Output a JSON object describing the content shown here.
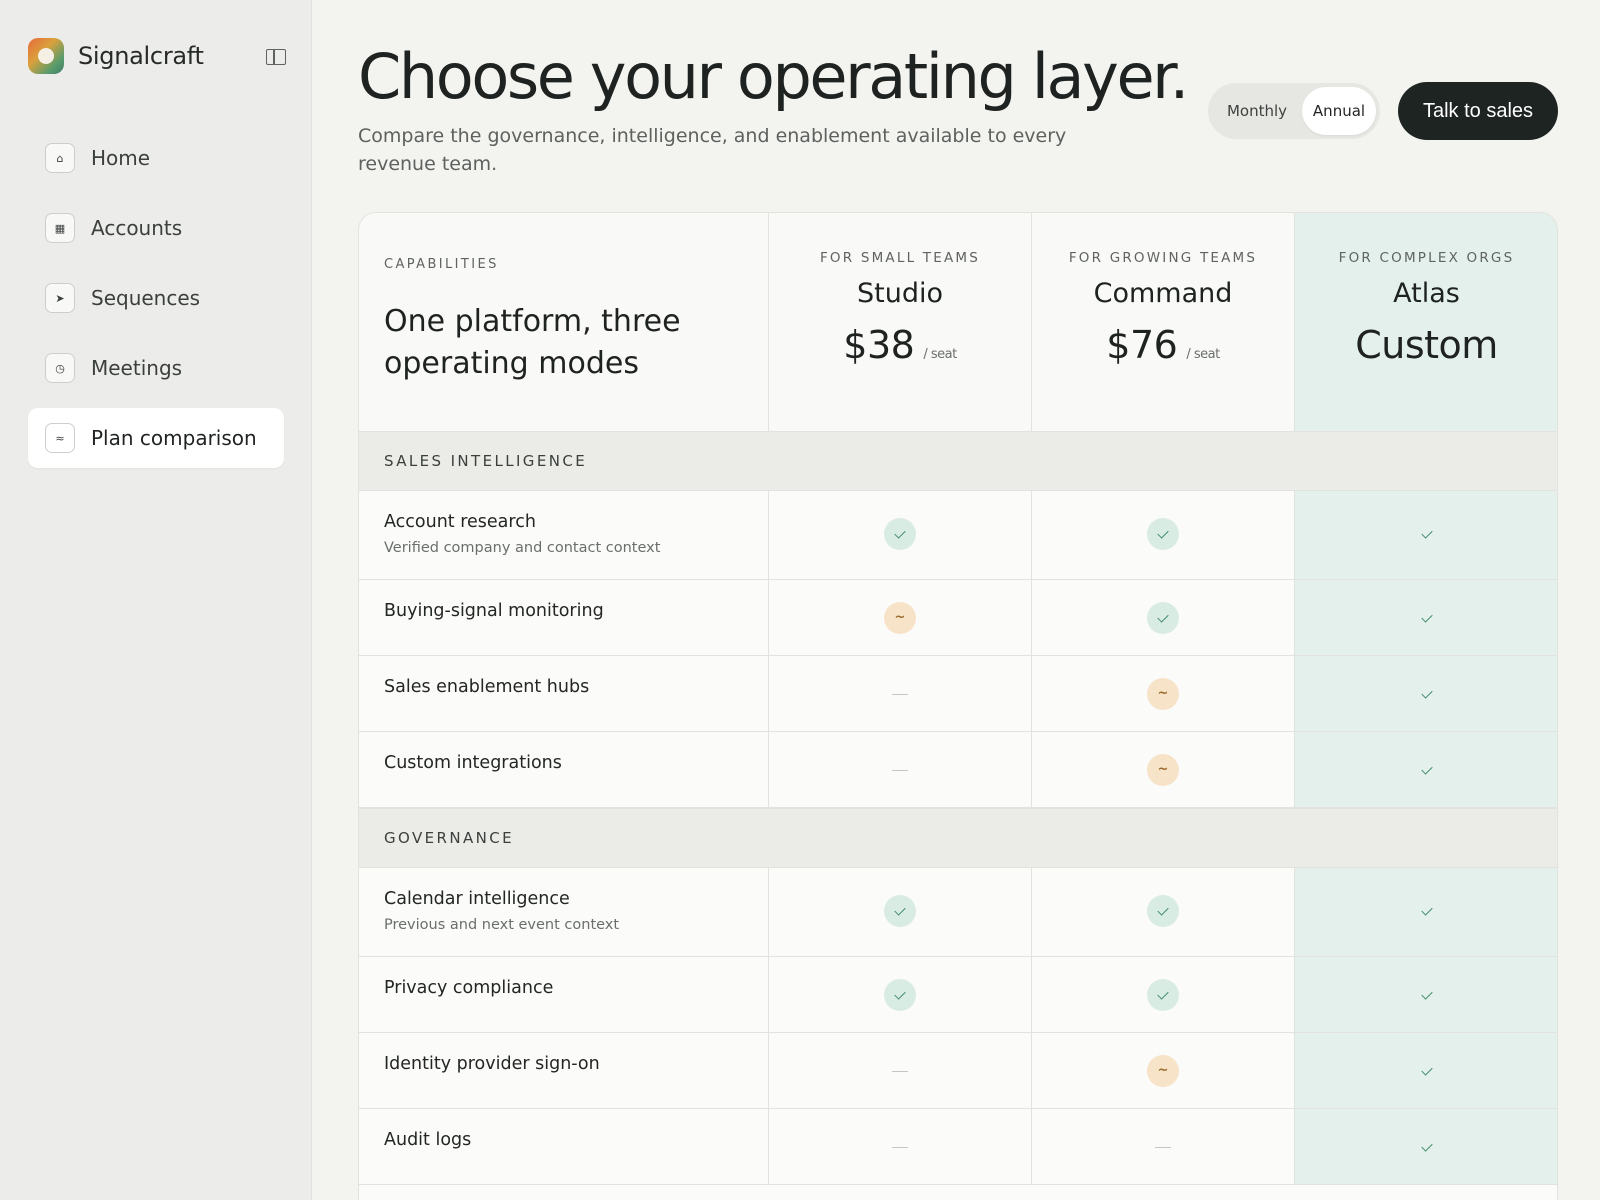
{
  "app": {
    "brand": "Signalcraft"
  },
  "sidebar": {
    "items": [
      {
        "label": "Home",
        "icon": "home-icon",
        "glyph": "⌂"
      },
      {
        "label": "Accounts",
        "icon": "accounts-icon",
        "glyph": "▦"
      },
      {
        "label": "Sequences",
        "icon": "sequences-icon",
        "glyph": "➤"
      },
      {
        "label": "Meetings",
        "icon": "meetings-icon",
        "glyph": "◷"
      },
      {
        "label": "Plan comparison",
        "icon": "plan-comparison-icon",
        "glyph": "≈",
        "active": true
      }
    ]
  },
  "header": {
    "title": "Choose your operating layer.",
    "subtitle": "Compare the governance, intelligence, and enablement available to every revenue team.",
    "billing_toggle": {
      "monthly": "Monthly",
      "annual": "Annual",
      "selected": "Annual"
    },
    "cta": "Talk to sales"
  },
  "table": {
    "capabilities_label": "CAPABILITIES",
    "capabilities_title": "One platform, three operating modes",
    "plans": [
      {
        "eyebrow": "FOR SMALL TEAMS",
        "name": "Studio",
        "price": "$38",
        "unit": "/ seat"
      },
      {
        "eyebrow": "FOR GROWING TEAMS",
        "name": "Command",
        "price": "$76",
        "unit": "/ seat"
      },
      {
        "eyebrow": "FOR COMPLEX ORGS",
        "name": "Atlas",
        "price": "Custom",
        "unit": ""
      }
    ],
    "sections": [
      {
        "label": "SALES INTELLIGENCE",
        "rows": [
          {
            "name": "Account research",
            "desc": "Verified company and contact context",
            "values": [
              "check",
              "check",
              "check"
            ]
          },
          {
            "name": "Buying-signal monitoring",
            "desc": "",
            "values": [
              "partial",
              "check",
              "check"
            ]
          },
          {
            "name": "Sales enablement hubs",
            "desc": "",
            "values": [
              "none",
              "partial",
              "check"
            ]
          },
          {
            "name": "Custom integrations",
            "desc": "",
            "values": [
              "none",
              "partial",
              "check"
            ]
          }
        ]
      },
      {
        "label": "GOVERNANCE",
        "rows": [
          {
            "name": "Calendar intelligence",
            "desc": "Previous and next event context",
            "values": [
              "check",
              "check",
              "check"
            ]
          },
          {
            "name": "Privacy compliance",
            "desc": "",
            "values": [
              "check",
              "check",
              "check"
            ]
          },
          {
            "name": "Identity provider sign-on",
            "desc": "",
            "values": [
              "none",
              "partial",
              "check"
            ]
          },
          {
            "name": "Audit logs",
            "desc": "",
            "values": [
              "none",
              "none",
              "check"
            ]
          }
        ]
      }
    ]
  },
  "colors": {
    "accent_dark": "#1d2422",
    "featured_bg": "#e3f0eb",
    "check_bg": "#d9ece4",
    "partial_bg": "#f7e3c8"
  }
}
